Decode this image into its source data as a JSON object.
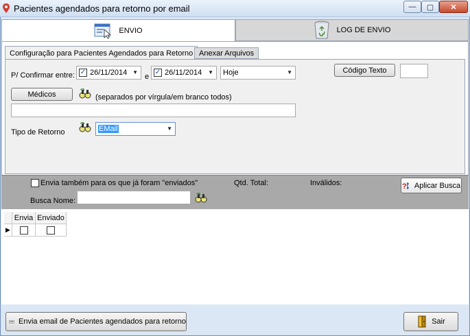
{
  "window": {
    "title": "Pacientes agendados para retorno por email",
    "minimize_glyph": "—",
    "maximize_glyph": "▢",
    "close_glyph": "✕"
  },
  "tabs": {
    "envio": "ENVIO",
    "log": "LOG DE ENVIO"
  },
  "inner_tabs": {
    "config": "Configuração para Pacientes Agendados para Retorno",
    "anexar": "Anexar Arquivos"
  },
  "form": {
    "confirm_label": "P/ Confirmar entre:",
    "date_from": "26/11/2014",
    "and_label": "e",
    "date_to": "26/11/2014",
    "period": "Hoje",
    "codigo_texto_button": "Código Texto",
    "codigo_texto_value": "",
    "medicos_button": "Médicos",
    "medicos_hint": "(separados por vírgula/em branco todos)",
    "medicos_value": "",
    "tipo_retorno_label": "Tipo de Retorno",
    "tipo_retorno_value": "EMail"
  },
  "filter": {
    "envia_tambem_label": "Envia também para os que já foram \"enviados\"",
    "qtd_total_label": "Qtd. Total:",
    "invalidos_label": "Inválidos:",
    "aplicar_busca_button": "Aplicar Busca",
    "busca_nome_label": "Busca Nome:",
    "busca_nome_value": ""
  },
  "grid": {
    "columns": [
      "Envia",
      "Enviado"
    ]
  },
  "footer": {
    "send_button": "Envia email de Pacientes agendados para retorno",
    "exit_button": "Sair"
  },
  "colors": {
    "window_bg": "#dbe7f5",
    "grey_band": "#a9a9a9",
    "accent_selection": "#3399ff"
  }
}
